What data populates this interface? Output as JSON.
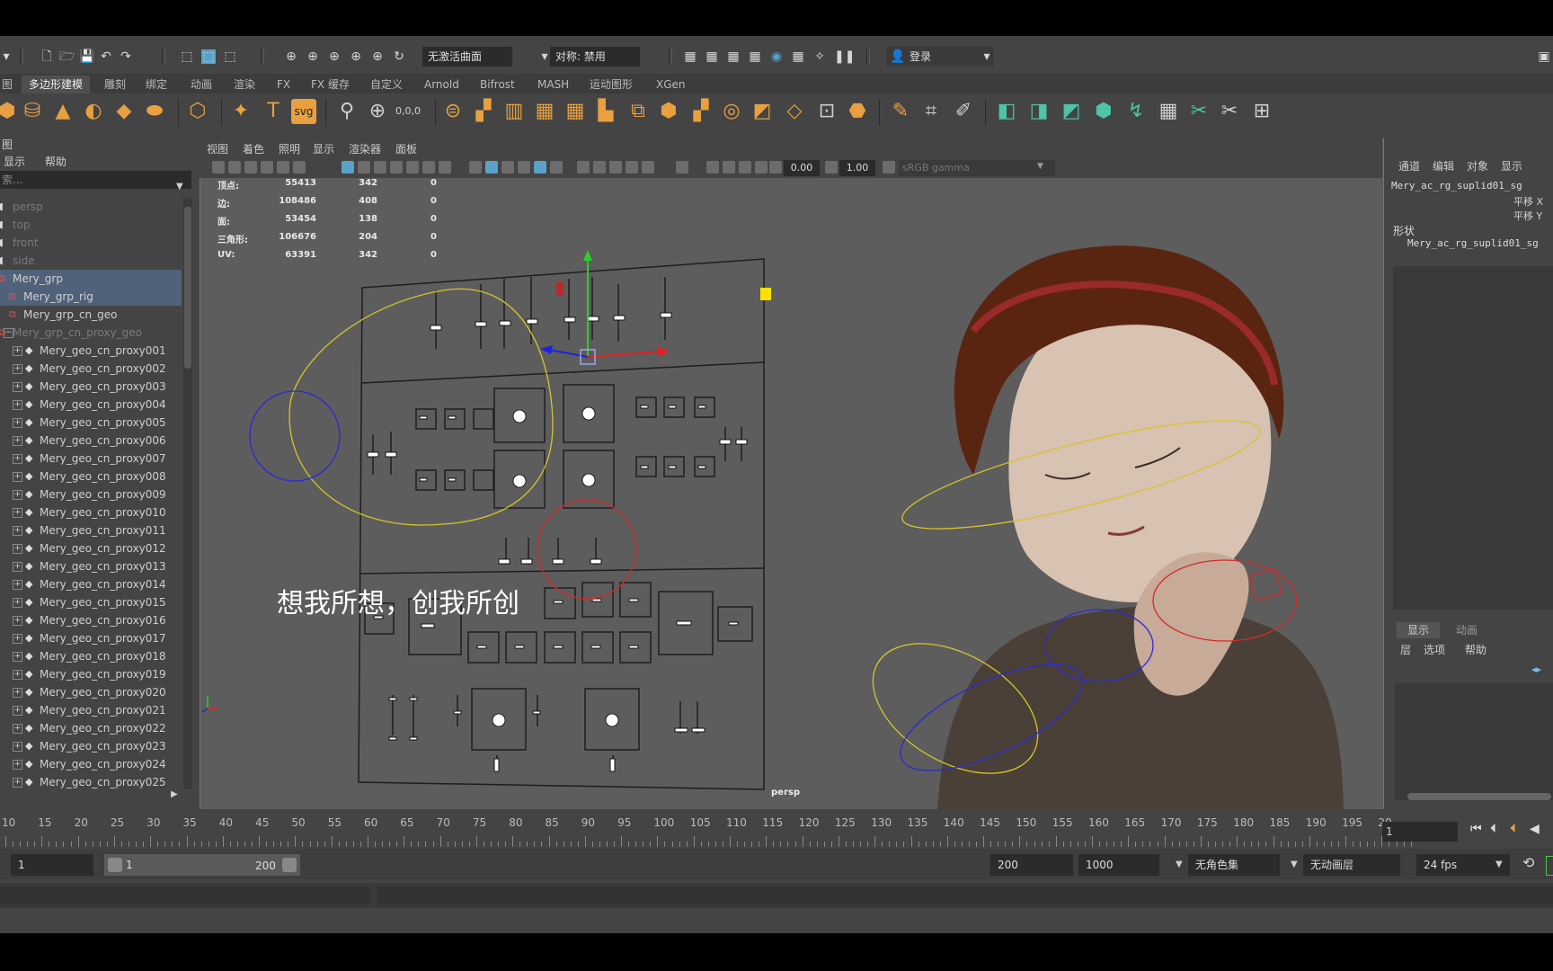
{
  "statusline": {
    "live_surface": "无激活曲面",
    "symmetry": "对称: 禁用",
    "login": "登录"
  },
  "shelf_tabs": [
    "图",
    "多边形建模",
    "雕刻",
    "绑定",
    "动画",
    "渲染",
    "FX",
    "FX 缓存",
    "自定义",
    "Arnold",
    "Bifrost",
    "MASH",
    "运动图形",
    "XGen"
  ],
  "shelf_active_index": 1,
  "outliner": {
    "title": "图",
    "menu": [
      "显示",
      "帮助"
    ],
    "search_placeholder": "索...",
    "items": [
      {
        "label": "persp",
        "icon": "camera-icon",
        "dim": true
      },
      {
        "label": "top",
        "icon": "camera-icon",
        "dim": true
      },
      {
        "label": "front",
        "icon": "camera-icon",
        "dim": true
      },
      {
        "label": "side",
        "icon": "camera-icon",
        "dim": true
      },
      {
        "label": "Mery_grp",
        "icon": "group-icon",
        "sel": true
      },
      {
        "label": "Mery_grp_rig",
        "icon": "group-icon",
        "sel": true
      },
      {
        "label": "Mery_grp_cn_geo",
        "icon": "group-icon"
      },
      {
        "label": "Mery_grp_cn_proxy_geo",
        "icon": "group-icon",
        "dim": true
      },
      {
        "label": "Mery_geo_cn_proxy001",
        "icon": "mesh-icon"
      },
      {
        "label": "Mery_geo_cn_proxy002",
        "icon": "mesh-icon"
      },
      {
        "label": "Mery_geo_cn_proxy003",
        "icon": "mesh-icon"
      },
      {
        "label": "Mery_geo_cn_proxy004",
        "icon": "mesh-icon"
      },
      {
        "label": "Mery_geo_cn_proxy005",
        "icon": "mesh-icon"
      },
      {
        "label": "Mery_geo_cn_proxy006",
        "icon": "mesh-icon"
      },
      {
        "label": "Mery_geo_cn_proxy007",
        "icon": "mesh-icon"
      },
      {
        "label": "Mery_geo_cn_proxy008",
        "icon": "mesh-icon"
      },
      {
        "label": "Mery_geo_cn_proxy009",
        "icon": "mesh-icon"
      },
      {
        "label": "Mery_geo_cn_proxy010",
        "icon": "mesh-icon"
      },
      {
        "label": "Mery_geo_cn_proxy011",
        "icon": "mesh-icon"
      },
      {
        "label": "Mery_geo_cn_proxy012",
        "icon": "mesh-icon"
      },
      {
        "label": "Mery_geo_cn_proxy013",
        "icon": "mesh-icon"
      },
      {
        "label": "Mery_geo_cn_proxy014",
        "icon": "mesh-icon"
      },
      {
        "label": "Mery_geo_cn_proxy015",
        "icon": "mesh-icon"
      },
      {
        "label": "Mery_geo_cn_proxy016",
        "icon": "mesh-icon"
      },
      {
        "label": "Mery_geo_cn_proxy017",
        "icon": "mesh-icon"
      },
      {
        "label": "Mery_geo_cn_proxy018",
        "icon": "mesh-icon"
      },
      {
        "label": "Mery_geo_cn_proxy019",
        "icon": "mesh-icon"
      },
      {
        "label": "Mery_geo_cn_proxy020",
        "icon": "mesh-icon"
      },
      {
        "label": "Mery_geo_cn_proxy021",
        "icon": "mesh-icon"
      },
      {
        "label": "Mery_geo_cn_proxy022",
        "icon": "mesh-icon"
      },
      {
        "label": "Mery_geo_cn_proxy023",
        "icon": "mesh-icon"
      },
      {
        "label": "Mery_geo_cn_proxy024",
        "icon": "mesh-icon"
      },
      {
        "label": "Mery_geo_cn_proxy025",
        "icon": "mesh-icon"
      }
    ]
  },
  "viewport": {
    "menu": [
      "视图",
      "着色",
      "照明",
      "显示",
      "渲染器",
      "面板"
    ],
    "exposure": "0.00",
    "gamma": "1.00",
    "color_space": "sRGB gamma",
    "camera_label": "persp",
    "subtitle": "想我所想，创我所创",
    "hud": [
      {
        "label": "顶点:",
        "a": "55413",
        "b": "342",
        "c": "0"
      },
      {
        "label": "边:",
        "a": "108486",
        "b": "408",
        "c": "0"
      },
      {
        "label": "面:",
        "a": "53454",
        "b": "138",
        "c": "0"
      },
      {
        "label": "三角形:",
        "a": "106676",
        "b": "204",
        "c": "0"
      },
      {
        "label": "UV:",
        "a": "63391",
        "b": "342",
        "c": "0"
      }
    ]
  },
  "channel_box": {
    "menu": [
      "通道",
      "编辑",
      "对象",
      "显示"
    ],
    "node": "Mery_ac_rg_suplid01_sg",
    "attrs": [
      "平移 X",
      "平移 Y"
    ],
    "shapes_label": "形状",
    "shape_node": "Mery_ac_rg_suplid01_sg"
  },
  "layer_editor": {
    "tabs": [
      "显示",
      "动画"
    ],
    "menu": [
      "层",
      "选项",
      "帮助"
    ]
  },
  "time_slider": {
    "ticks": [
      "10",
      "15",
      "20",
      "25",
      "30",
      "35",
      "40",
      "45",
      "50",
      "55",
      "60",
      "65",
      "70",
      "75",
      "80",
      "85",
      "90",
      "95",
      "100",
      "105",
      "110",
      "115",
      "120",
      "125",
      "130",
      "135",
      "140",
      "145",
      "150",
      "155",
      "160",
      "165",
      "170",
      "175",
      "180",
      "185",
      "190",
      "195",
      "20"
    ],
    "current_frame": "1"
  },
  "range_slider": {
    "start": "1",
    "inner_start": "1",
    "inner_end": "200",
    "end": "200",
    "anim_end": "1000",
    "character_set": "无角色集",
    "anim_layer": "无动画层",
    "fps": "24 fps"
  },
  "colors": {
    "accent_blue": "#5aa2c8",
    "selection": "#50627a",
    "shelf_orange": "#e8a040",
    "shelf_teal": "#4fc3a6"
  }
}
